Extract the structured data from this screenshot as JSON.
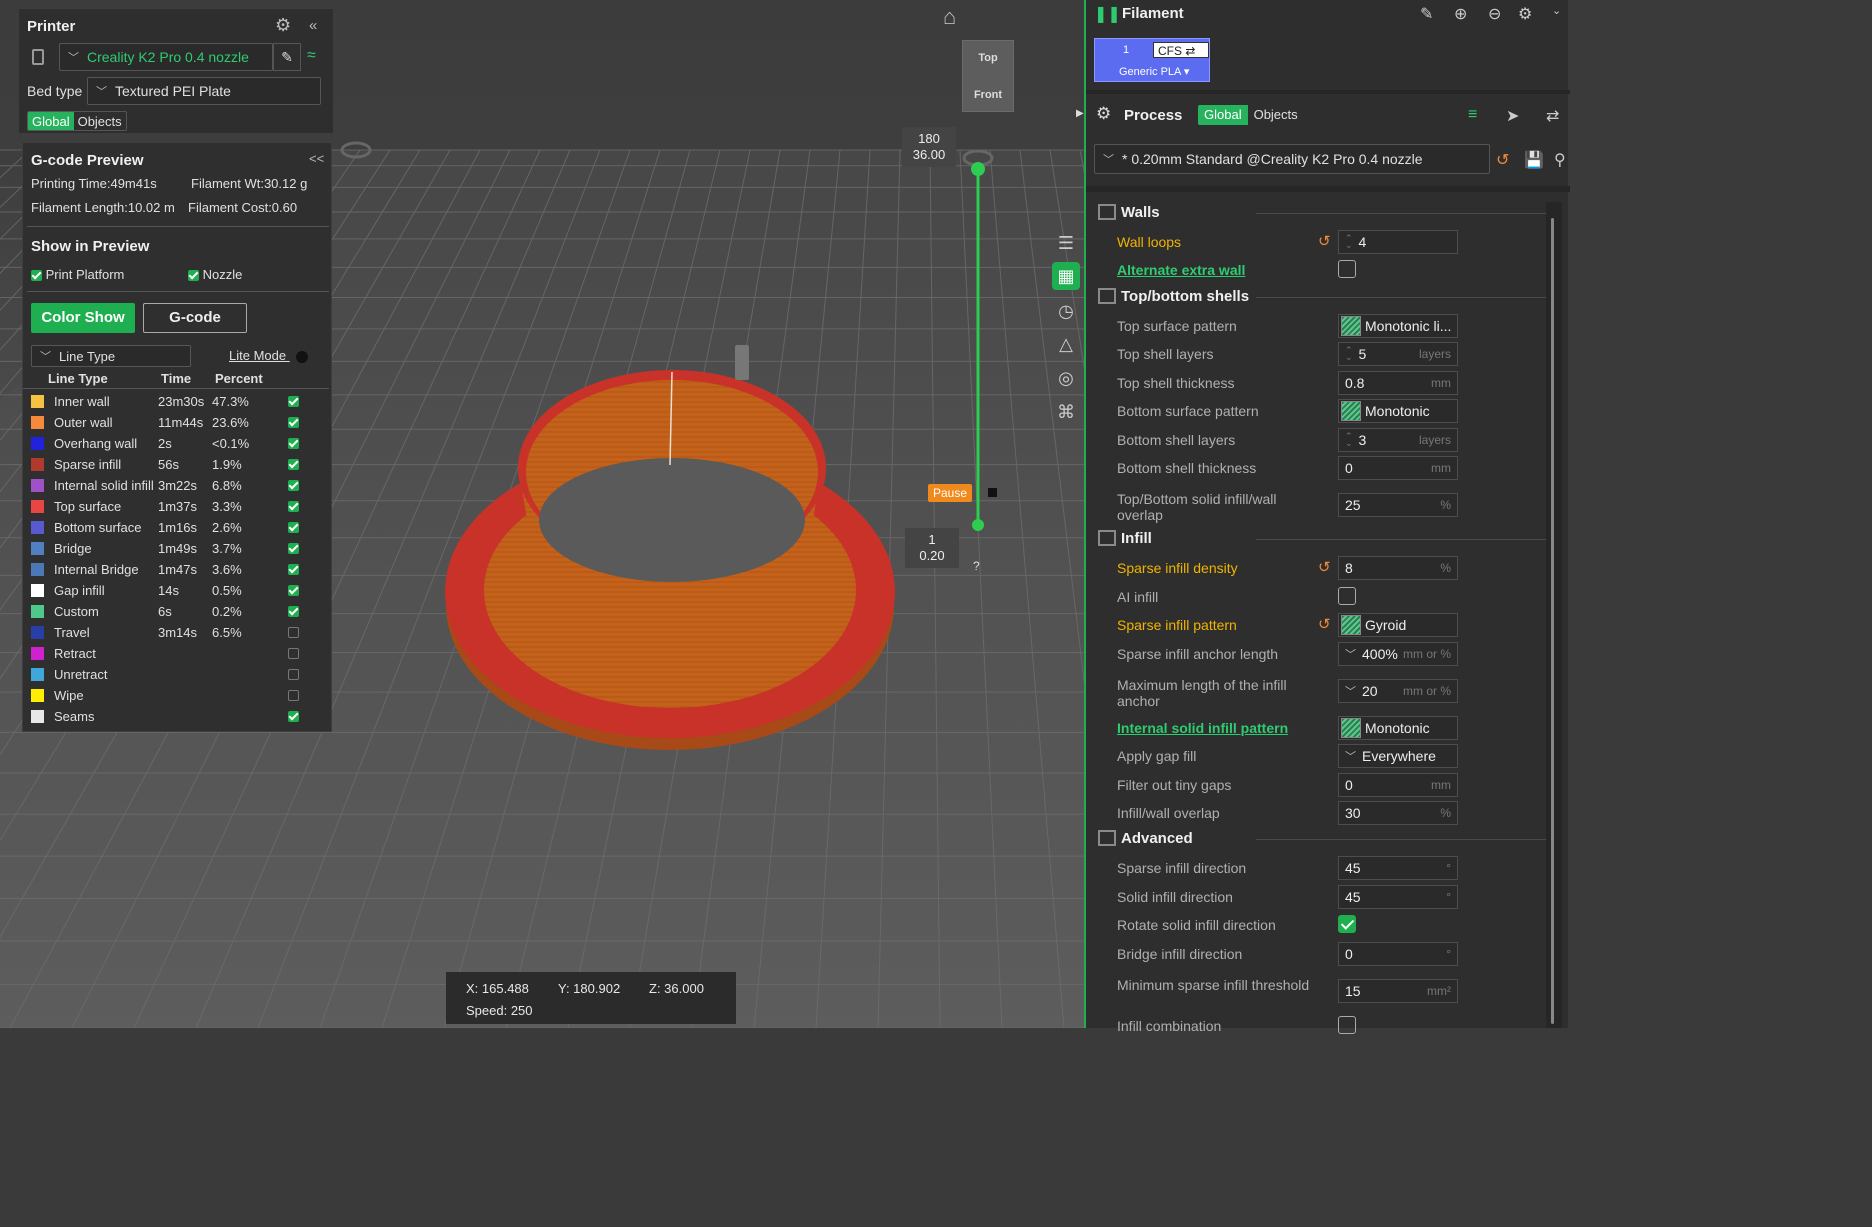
{
  "printer": {
    "title": "Printer",
    "printer_name": "Creality K2 Pro 0.4 nozzle",
    "bed_type_label": "Bed type",
    "bed_type": "Textured PEI Plate",
    "tab_global": "Global",
    "tab_objects": "Objects"
  },
  "gcode": {
    "title": "G-code Preview",
    "printing_time": "Printing Time:49m41s",
    "filament_wt": "Filament Wt:30.12 g",
    "filament_length": "Filament Length:10.02 m",
    "filament_cost": "Filament Cost:0.60",
    "show_title": "Show in Preview",
    "print_platform": "Print Platform",
    "nozzle": "Nozzle",
    "color_show": "Color Show",
    "gcode_btn": "G-code",
    "line_type_dropdown": "Line Type",
    "lite_mode": "Lite Mode",
    "headers": [
      "Line Type",
      "Time",
      "Percent"
    ],
    "rows": [
      {
        "name": "Inner wall",
        "time": "23m30s",
        "percent": "47.3%",
        "color": "#f5c242",
        "checked": true
      },
      {
        "name": "Outer wall",
        "time": "11m44s",
        "percent": "23.6%",
        "color": "#f58a3c",
        "checked": true
      },
      {
        "name": "Overhang wall",
        "time": "2s",
        "percent": "<0.1%",
        "color": "#2222dd",
        "checked": true
      },
      {
        "name": "Sparse infill",
        "time": "56s",
        "percent": "1.9%",
        "color": "#b03a2e",
        "checked": true
      },
      {
        "name": "Internal solid infill",
        "time": "3m22s",
        "percent": "6.8%",
        "color": "#a050c8",
        "checked": true
      },
      {
        "name": "Top surface",
        "time": "1m37s",
        "percent": "3.3%",
        "color": "#e84545",
        "checked": true
      },
      {
        "name": "Bottom surface",
        "time": "1m16s",
        "percent": "2.6%",
        "color": "#5a5ad0",
        "checked": true
      },
      {
        "name": "Bridge",
        "time": "1m49s",
        "percent": "3.7%",
        "color": "#5080c0",
        "checked": true
      },
      {
        "name": "Internal Bridge",
        "time": "1m47s",
        "percent": "3.6%",
        "color": "#4a78b8",
        "checked": true
      },
      {
        "name": "Gap infill",
        "time": "14s",
        "percent": "0.5%",
        "color": "#ffffff",
        "checked": true
      },
      {
        "name": "Custom",
        "time": "6s",
        "percent": "0.2%",
        "color": "#4ec98a",
        "checked": true
      },
      {
        "name": "Travel",
        "time": "3m14s",
        "percent": "6.5%",
        "color": "#2a3ea8",
        "checked": false
      },
      {
        "name": "Retract",
        "time": "",
        "percent": "",
        "color": "#d020d0",
        "checked": false
      },
      {
        "name": "Unretract",
        "time": "",
        "percent": "",
        "color": "#40a8d8",
        "checked": false
      },
      {
        "name": "Wipe",
        "time": "",
        "percent": "",
        "color": "#ffee00",
        "checked": false
      },
      {
        "name": "Seams",
        "time": "",
        "percent": "",
        "color": "#e8e8e8",
        "checked": true
      }
    ]
  },
  "viewport": {
    "cube_top": "Top",
    "cube_front": "Front",
    "layer_top_1": "180",
    "layer_top_2": "36.00",
    "layer_bottom_1": "1",
    "layer_bottom_2": "0.20",
    "pause": "Pause",
    "help": "?",
    "coords_x": "X: 165.488",
    "coords_y": "Y: 180.902",
    "coords_z": "Z: 36.000",
    "speed": "Speed: 250"
  },
  "filament": {
    "title": "Filament",
    "slot": "1",
    "cfs": "CFS ⇄",
    "material": "Generic PLA ▾",
    "slot_color": "#5b6cf0"
  },
  "process": {
    "title": "Process",
    "tab_global": "Global",
    "tab_objects": "Objects",
    "preset": "* 0.20mm Standard @Creality K2 Pro 0.4 nozzle"
  },
  "sections": {
    "walls": "Walls",
    "topbottom": "Top/bottom shells",
    "infill": "Infill",
    "advanced": "Advanced"
  },
  "params": {
    "wall_loops": {
      "label": "Wall loops",
      "value": "4"
    },
    "alt_extra_wall": {
      "label": "Alternate extra wall"
    },
    "top_surface_pattern": {
      "label": "Top surface pattern",
      "value": "Monotonic li..."
    },
    "top_shell_layers": {
      "label": "Top shell layers",
      "value": "5",
      "unit": "layers"
    },
    "top_shell_thickness": {
      "label": "Top shell thickness",
      "value": "0.8",
      "unit": "mm"
    },
    "bottom_surface_pattern": {
      "label": "Bottom surface pattern",
      "value": "Monotonic"
    },
    "bottom_shell_layers": {
      "label": "Bottom shell layers",
      "value": "3",
      "unit": "layers"
    },
    "bottom_shell_thickness": {
      "label": "Bottom shell thickness",
      "value": "0",
      "unit": "mm"
    },
    "tb_overlap": {
      "label": "Top/Bottom solid infill/wall overlap",
      "value": "25",
      "unit": "%"
    },
    "sparse_density": {
      "label": "Sparse infill density",
      "value": "8",
      "unit": "%"
    },
    "ai_infill": {
      "label": "AI infill"
    },
    "sparse_pattern": {
      "label": "Sparse infill pattern",
      "value": "Gyroid"
    },
    "anchor_length": {
      "label": "Sparse infill anchor length",
      "value": "400%",
      "unit": "mm or %"
    },
    "max_anchor": {
      "label": "Maximum length of the infill anchor",
      "value": "20",
      "unit": "mm or %"
    },
    "internal_solid_pattern": {
      "label": "Internal solid infill pattern",
      "value": "Monotonic"
    },
    "gap_fill": {
      "label": "Apply gap fill",
      "value": "Everywhere"
    },
    "filter_gaps": {
      "label": "Filter out tiny gaps",
      "value": "0",
      "unit": "mm"
    },
    "infill_wall_overlap": {
      "label": "Infill/wall overlap",
      "value": "30",
      "unit": "%"
    },
    "sparse_dir": {
      "label": "Sparse infill direction",
      "value": "45",
      "unit": "°"
    },
    "solid_dir": {
      "label": "Solid infill direction",
      "value": "45",
      "unit": "°"
    },
    "rotate_solid": {
      "label": "Rotate solid infill direction"
    },
    "bridge_dir": {
      "label": "Bridge infill direction",
      "value": "0",
      "unit": "°"
    },
    "min_sparse": {
      "label": "Minimum sparse infill threshold",
      "value": "15",
      "unit": "mm²"
    },
    "infill_combination": {
      "label": "Infill combination"
    }
  },
  "colors": {
    "accent": "#1eaf50",
    "modified": "#f0b400",
    "model": "#c8651e",
    "model_edge": "#c83228"
  }
}
